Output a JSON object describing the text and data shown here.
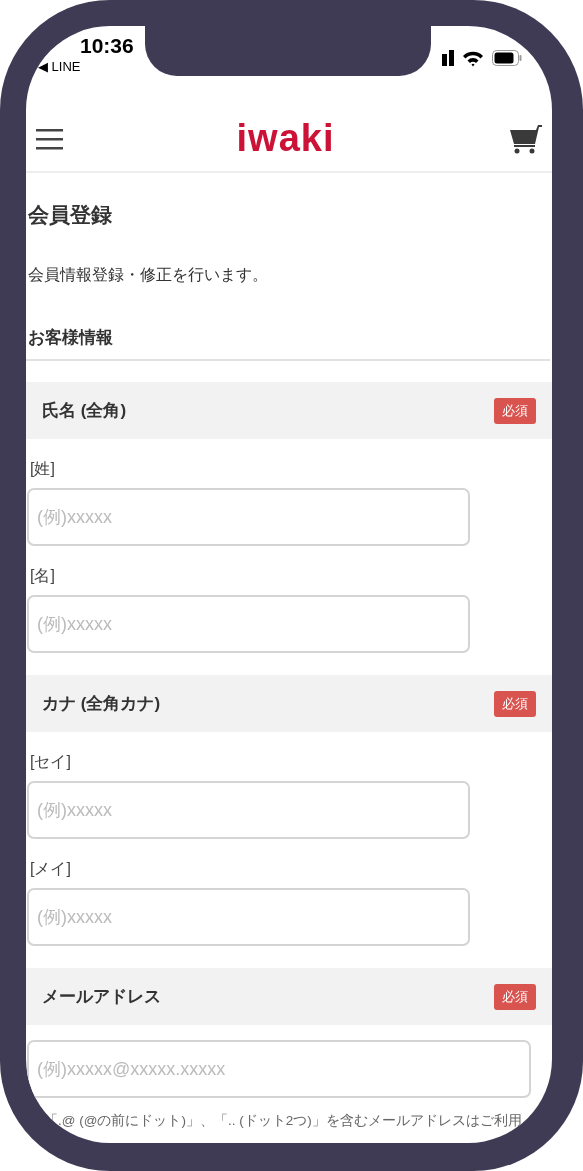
{
  "status_bar": {
    "time": "10:36",
    "back_label": "◀ LINE"
  },
  "header": {
    "logo": "iwaki"
  },
  "page_title": "会員登録",
  "description": "会員情報登録・修正を行います。",
  "section_title": "お客様情報",
  "groups": [
    {
      "kind": "pair",
      "label": "氏名 (全角)",
      "required": true,
      "badge": "必須",
      "inputs": [
        {
          "sublabel": "[姓]",
          "placeholder": "(例)xxxxx"
        },
        {
          "sublabel": "[名]",
          "placeholder": "(例)xxxxx"
        }
      ]
    },
    {
      "kind": "pair",
      "label": "カナ (全角カナ)",
      "required": true,
      "badge": "必須",
      "inputs": [
        {
          "sublabel": "[セイ]",
          "placeholder": "(例)xxxxx"
        },
        {
          "sublabel": "[メイ]",
          "placeholder": "(例)xxxxx"
        }
      ]
    },
    {
      "kind": "single",
      "label": "メールアドレス",
      "required": true,
      "badge": "必須",
      "inputs": [
        {
          "placeholder": "(例)xxxxx@xxxxx.xxxxx"
        }
      ],
      "note": "「.@ (@の前にドット)」、「.. (ドット2つ)」を含むメールアドレスはご利用"
    }
  ]
}
